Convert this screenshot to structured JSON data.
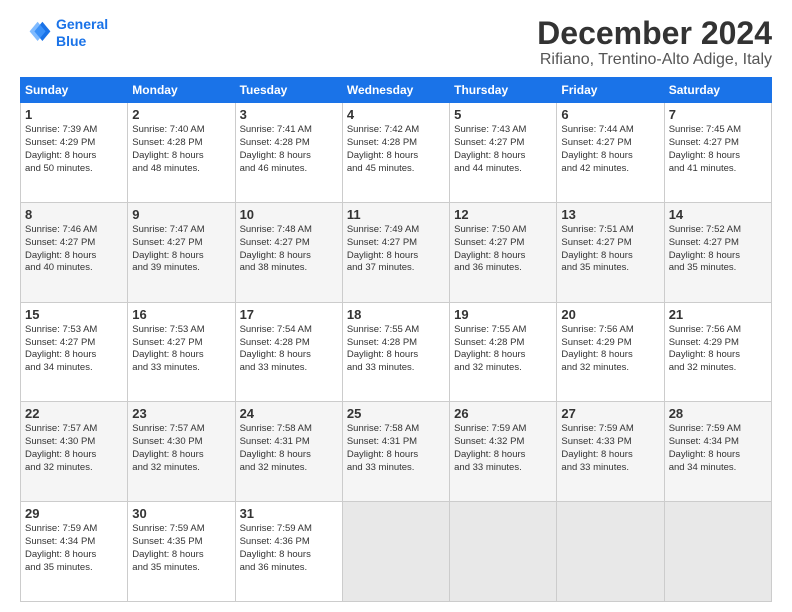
{
  "logo": {
    "line1": "General",
    "line2": "Blue"
  },
  "title": "December 2024",
  "subtitle": "Rifiano, Trentino-Alto Adige, Italy",
  "header_days": [
    "Sunday",
    "Monday",
    "Tuesday",
    "Wednesday",
    "Thursday",
    "Friday",
    "Saturday"
  ],
  "weeks": [
    [
      {
        "day": "1",
        "info": "Sunrise: 7:39 AM\nSunset: 4:29 PM\nDaylight: 8 hours\nand 50 minutes."
      },
      {
        "day": "2",
        "info": "Sunrise: 7:40 AM\nSunset: 4:28 PM\nDaylight: 8 hours\nand 48 minutes."
      },
      {
        "day": "3",
        "info": "Sunrise: 7:41 AM\nSunset: 4:28 PM\nDaylight: 8 hours\nand 46 minutes."
      },
      {
        "day": "4",
        "info": "Sunrise: 7:42 AM\nSunset: 4:28 PM\nDaylight: 8 hours\nand 45 minutes."
      },
      {
        "day": "5",
        "info": "Sunrise: 7:43 AM\nSunset: 4:27 PM\nDaylight: 8 hours\nand 44 minutes."
      },
      {
        "day": "6",
        "info": "Sunrise: 7:44 AM\nSunset: 4:27 PM\nDaylight: 8 hours\nand 42 minutes."
      },
      {
        "day": "7",
        "info": "Sunrise: 7:45 AM\nSunset: 4:27 PM\nDaylight: 8 hours\nand 41 minutes."
      }
    ],
    [
      {
        "day": "8",
        "info": "Sunrise: 7:46 AM\nSunset: 4:27 PM\nDaylight: 8 hours\nand 40 minutes."
      },
      {
        "day": "9",
        "info": "Sunrise: 7:47 AM\nSunset: 4:27 PM\nDaylight: 8 hours\nand 39 minutes."
      },
      {
        "day": "10",
        "info": "Sunrise: 7:48 AM\nSunset: 4:27 PM\nDaylight: 8 hours\nand 38 minutes."
      },
      {
        "day": "11",
        "info": "Sunrise: 7:49 AM\nSunset: 4:27 PM\nDaylight: 8 hours\nand 37 minutes."
      },
      {
        "day": "12",
        "info": "Sunrise: 7:50 AM\nSunset: 4:27 PM\nDaylight: 8 hours\nand 36 minutes."
      },
      {
        "day": "13",
        "info": "Sunrise: 7:51 AM\nSunset: 4:27 PM\nDaylight: 8 hours\nand 35 minutes."
      },
      {
        "day": "14",
        "info": "Sunrise: 7:52 AM\nSunset: 4:27 PM\nDaylight: 8 hours\nand 35 minutes."
      }
    ],
    [
      {
        "day": "15",
        "info": "Sunrise: 7:53 AM\nSunset: 4:27 PM\nDaylight: 8 hours\nand 34 minutes."
      },
      {
        "day": "16",
        "info": "Sunrise: 7:53 AM\nSunset: 4:27 PM\nDaylight: 8 hours\nand 33 minutes."
      },
      {
        "day": "17",
        "info": "Sunrise: 7:54 AM\nSunset: 4:28 PM\nDaylight: 8 hours\nand 33 minutes."
      },
      {
        "day": "18",
        "info": "Sunrise: 7:55 AM\nSunset: 4:28 PM\nDaylight: 8 hours\nand 33 minutes."
      },
      {
        "day": "19",
        "info": "Sunrise: 7:55 AM\nSunset: 4:28 PM\nDaylight: 8 hours\nand 32 minutes."
      },
      {
        "day": "20",
        "info": "Sunrise: 7:56 AM\nSunset: 4:29 PM\nDaylight: 8 hours\nand 32 minutes."
      },
      {
        "day": "21",
        "info": "Sunrise: 7:56 AM\nSunset: 4:29 PM\nDaylight: 8 hours\nand 32 minutes."
      }
    ],
    [
      {
        "day": "22",
        "info": "Sunrise: 7:57 AM\nSunset: 4:30 PM\nDaylight: 8 hours\nand 32 minutes."
      },
      {
        "day": "23",
        "info": "Sunrise: 7:57 AM\nSunset: 4:30 PM\nDaylight: 8 hours\nand 32 minutes."
      },
      {
        "day": "24",
        "info": "Sunrise: 7:58 AM\nSunset: 4:31 PM\nDaylight: 8 hours\nand 32 minutes."
      },
      {
        "day": "25",
        "info": "Sunrise: 7:58 AM\nSunset: 4:31 PM\nDaylight: 8 hours\nand 33 minutes."
      },
      {
        "day": "26",
        "info": "Sunrise: 7:59 AM\nSunset: 4:32 PM\nDaylight: 8 hours\nand 33 minutes."
      },
      {
        "day": "27",
        "info": "Sunrise: 7:59 AM\nSunset: 4:33 PM\nDaylight: 8 hours\nand 33 minutes."
      },
      {
        "day": "28",
        "info": "Sunrise: 7:59 AM\nSunset: 4:34 PM\nDaylight: 8 hours\nand 34 minutes."
      }
    ],
    [
      {
        "day": "29",
        "info": "Sunrise: 7:59 AM\nSunset: 4:34 PM\nDaylight: 8 hours\nand 35 minutes."
      },
      {
        "day": "30",
        "info": "Sunrise: 7:59 AM\nSunset: 4:35 PM\nDaylight: 8 hours\nand 35 minutes."
      },
      {
        "day": "31",
        "info": "Sunrise: 7:59 AM\nSunset: 4:36 PM\nDaylight: 8 hours\nand 36 minutes."
      },
      null,
      null,
      null,
      null
    ]
  ]
}
